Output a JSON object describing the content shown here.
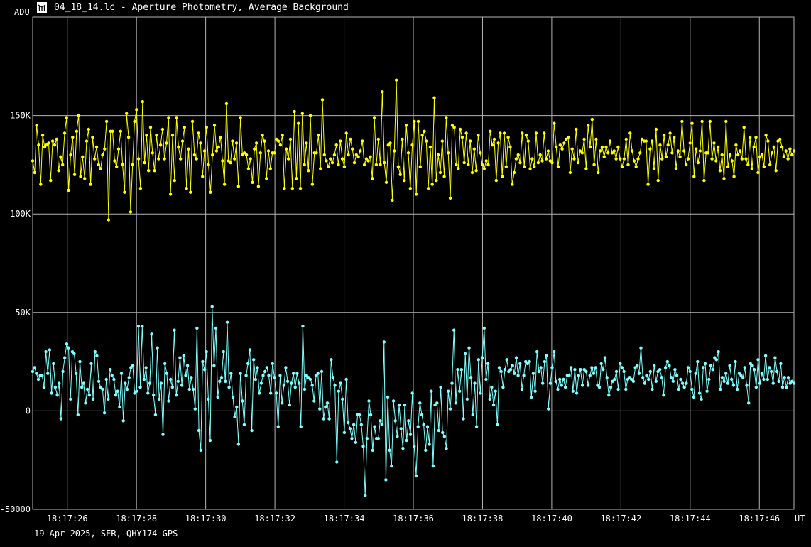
{
  "window": {
    "title": "04_18_14.lc - Aperture Photometry, Average Background",
    "icon": "app-icon"
  },
  "footer": {
    "text": "19 Apr 2025, SER, QHY174-GPS"
  },
  "colors": {
    "background": "#000000",
    "grid": "#b4b4b4",
    "series_target": "#ffff00",
    "series_background": "#80ffff"
  },
  "chart_data": {
    "type": "line",
    "y_unit_label": "ADU",
    "x_unit_label": "UT",
    "xlim": [
      "18:17:25",
      "18:17:47"
    ],
    "ylim": [
      -50000,
      200000
    ],
    "grid": true,
    "x_ticks": [
      "18:17:26",
      "18:17:28",
      "18:17:30",
      "18:17:32",
      "18:17:34",
      "18:17:36",
      "18:17:38",
      "18:17:40",
      "18:17:42",
      "18:17:44",
      "18:17:46"
    ],
    "y_ticks": [
      {
        "value": -50000,
        "label": "-50000"
      },
      {
        "value": 0,
        "label": "0"
      },
      {
        "value": 50000,
        "label": "50K"
      },
      {
        "value": 100000,
        "label": "100K"
      },
      {
        "value": 150000,
        "label": "150K"
      }
    ],
    "series": [
      {
        "color": "#ffff00",
        "style": "line-with-dots",
        "x_start": "18:17:25.0",
        "x_end": "18:17:47.0",
        "values": [
          127000,
          121000,
          145000,
          135000,
          115000,
          140000,
          134000,
          135000,
          136000,
          117000,
          137000,
          135000,
          138000,
          122000,
          129000,
          125000,
          141000,
          149000,
          112000,
          130000,
          139000,
          120000,
          142000,
          150000,
          119000,
          129000,
          118000,
          137000,
          143000,
          115000,
          139000,
          128000,
          134000,
          125000,
          123000,
          130000,
          133000,
          147000,
          97000,
          142000,
          142000,
          127000,
          124000,
          133000,
          142000,
          125000,
          111000,
          151000,
          139000,
          101000,
          125000,
          147000,
          153000,
          128000,
          113000,
          157000,
          126000,
          140000,
          122000,
          144000,
          131000,
          122000,
          140000,
          128000,
          135000,
          143000,
          128000,
          136000,
          149000,
          110000,
          140000,
          117000,
          149000,
          134000,
          128000,
          137000,
          144000,
          113000,
          133000,
          111000,
          147000,
          130000,
          128000,
          141000,
          136000,
          119000,
          132000,
          144000,
          125000,
          111000,
          130000,
          145000,
          132000,
          134000,
          139000,
          127000,
          115000,
          156000,
          127000,
          126000,
          137000,
          128000,
          136000,
          114000,
          149000,
          130000,
          131000,
          130000,
          123000,
          128000,
          116000,
          133000,
          136000,
          114000,
          131000,
          140000,
          137000,
          118000,
          132000,
          123000,
          131000,
          131000,
          138000,
          137000,
          135000,
          140000,
          113000,
          133000,
          128000,
          138000,
          113000,
          152000,
          118000,
          146000,
          113000,
          151000,
          125000,
          136000,
          122000,
          150000,
          115000,
          131000,
          131000,
          140000,
          123000,
          158000,
          130000,
          127000,
          124000,
          128000,
          126000,
          130000,
          135000,
          125000,
          137000,
          128000,
          124000,
          141000,
          130000,
          138000,
          133000,
          126000,
          130000,
          129000,
          132000,
          137000,
          125000,
          128000,
          127000,
          129000,
          118000,
          149000,
          125000,
          138000,
          125000,
          162000,
          126000,
          116000,
          135000,
          136000,
          107000,
          132000,
          168000,
          124000,
          120000,
          138000,
          117000,
          145000,
          131000,
          113000,
          135000,
          147000,
          110000,
          147000,
          124000,
          140000,
          142000,
          137000,
          113000,
          134000,
          115000,
          159000,
          117000,
          130000,
          121000,
          137000,
          119000,
          149000,
          131000,
          108000,
          145000,
          144000,
          125000,
          123000,
          143000,
          139000,
          126000,
          141000,
          125000,
          137000,
          121000,
          133000,
          122000,
          140000,
          131000,
          125000,
          123000,
          127000,
          125000,
          142000,
          135000,
          138000,
          117000,
          136000,
          141000,
          119000,
          141000,
          124000,
          139000,
          134000,
          115000,
          121000,
          128000,
          130000,
          126000,
          141000,
          124000,
          140000,
          137000,
          123000,
          128000,
          124000,
          141000,
          126000,
          130000,
          127000,
          141000,
          128000,
          132000,
          127000,
          126000,
          146000,
          134000,
          124000,
          135000,
          133000,
          136000,
          138000,
          139000,
          121000,
          133000,
          128000,
          143000,
          126000,
          132000,
          131000,
          138000,
          123000,
          145000,
          134000,
          148000,
          125000,
          138000,
          121000,
          132000,
          134000,
          129000,
          134000,
          131000,
          137000,
          131000,
          132000,
          128000,
          134000,
          128000,
          124000,
          128000,
          138000,
          125000,
          141000,
          132000,
          127000,
          124000,
          128000,
          131000,
          138000,
          137000,
          137000,
          115000,
          133000,
          137000,
          123000,
          143000,
          117000,
          135000,
          128000,
          140000,
          129000,
          135000,
          141000,
          131000,
          139000,
          123000,
          132000,
          129000,
          147000,
          132000,
          125000,
          128000,
          136000,
          146000,
          119000,
          133000,
          126000,
          132000,
          147000,
          117000,
          131000,
          131000,
          147000,
          128000,
          136000,
          127000,
          134000,
          122000,
          130000,
          118000,
          147000,
          124000,
          130000,
          127000,
          119000,
          135000,
          130000,
          132000,
          128000,
          144000,
          128000,
          125000,
          139000,
          123000,
          134000,
          139000,
          121000,
          129000,
          130000,
          124000,
          140000,
          137000,
          125000,
          131000,
          134000,
          122000,
          137000,
          138000,
          134000,
          129000,
          132000,
          128000,
          133000,
          130000,
          132000
        ]
      },
      {
        "color": "#80ffff",
        "style": "line-with-dots",
        "x_start": "18:17:25.0",
        "x_end": "18:17:47.0",
        "values": [
          20000,
          22000,
          19000,
          16000,
          18000,
          18000,
          12000,
          30000,
          19000,
          31000,
          9000,
          24000,
          12000,
          8000,
          14000,
          -4000,
          20000,
          27000,
          34000,
          32000,
          6000,
          30000,
          29000,
          19000,
          -2000,
          25000,
          12000,
          14000,
          4000,
          11000,
          8000,
          24000,
          6000,
          30000,
          28000,
          15000,
          12000,
          11000,
          -1000,
          16000,
          6000,
          21000,
          18000,
          16000,
          8000,
          10000,
          2000,
          19000,
          -5000,
          14000,
          11000,
          17000,
          22000,
          23000,
          9000,
          10000,
          43000,
          12000,
          43000,
          16000,
          22000,
          9000,
          14000,
          39000,
          8000,
          -2000,
          32000,
          6000,
          14000,
          -12000,
          24000,
          19000,
          5000,
          16000,
          12000,
          41000,
          8000,
          15000,
          27000,
          13000,
          28000,
          18000,
          23000,
          11000,
          17000,
          11000,
          1000,
          42000,
          -10000,
          -20000,
          25000,
          21000,
          30000,
          6000,
          -15000,
          53000,
          23000,
          42000,
          7000,
          15000,
          17000,
          30000,
          15000,
          45000,
          12000,
          19000,
          7000,
          -3000,
          2000,
          -17000,
          19000,
          5000,
          -7000,
          18000,
          24000,
          31000,
          -10000,
          26000,
          16000,
          22000,
          9000,
          14000,
          18000,
          20000,
          22000,
          18000,
          9000,
          24000,
          17000,
          9000,
          -8000,
          18000,
          4000,
          13000,
          22000,
          15000,
          3000,
          14000,
          19000,
          12000,
          19000,
          14000,
          -8000,
          43000,
          11000,
          18000,
          17000,
          16000,
          13000,
          5000,
          18000,
          19000,
          1000,
          20000,
          -4000,
          2000,
          4000,
          -4000,
          26000,
          17000,
          13000,
          -26000,
          10000,
          14000,
          6000,
          -11000,
          16000,
          -6000,
          -9000,
          -14000,
          -7000,
          -16000,
          -2000,
          -2000,
          -7000,
          -18000,
          -43000,
          -14000,
          5000,
          -2000,
          -20000,
          -8000,
          -14000,
          -14000,
          -5000,
          -7000,
          35000,
          -35000,
          7000,
          -20000,
          -28000,
          5000,
          -5000,
          -13000,
          3000,
          -9000,
          -19000,
          3000,
          -15000,
          -5000,
          -12000,
          9000,
          -18000,
          -33000,
          -8000,
          4000,
          -2000,
          -7000,
          -20000,
          -8000,
          -17000,
          10000,
          -28000,
          3000,
          4000,
          -10000,
          12000,
          -11000,
          -13000,
          -19000,
          10000,
          1000,
          14000,
          41000,
          4000,
          21000,
          10000,
          21000,
          -4000,
          29000,
          6000,
          32000,
          17000,
          -2000,
          14000,
          -8000,
          26000,
          9000,
          27000,
          42000,
          16000,
          24000,
          6000,
          12000,
          3000,
          10000,
          -7000,
          22000,
          20000,
          12000,
          21000,
          26000,
          20000,
          21000,
          23000,
          19000,
          27000,
          18000,
          24000,
          11000,
          18000,
          25000,
          24000,
          25000,
          7000,
          19000,
          10000,
          30000,
          20000,
          22000,
          14000,
          25000,
          28000,
          1000,
          14000,
          22000,
          30000,
          15000,
          11000,
          16000,
          13000,
          16000,
          12000,
          18000,
          18000,
          22000,
          10000,
          21000,
          9000,
          18000,
          21000,
          13000,
          21000,
          20000,
          13000,
          18000,
          22000,
          19000,
          22000,
          13000,
          12000,
          24000,
          21000,
          27000,
          17000,
          8000,
          12000,
          15000,
          16000,
          20000,
          11000,
          24000,
          22000,
          20000,
          11000,
          16000,
          17000,
          16000,
          15000,
          22000,
          23000,
          19000,
          32000,
          17000,
          14000,
          18000,
          16000,
          20000,
          11000,
          23000,
          15000,
          20000,
          21000,
          17000,
          8000,
          22000,
          25000,
          23000,
          17000,
          15000,
          21000,
          18000,
          11000,
          16000,
          14000,
          12000,
          14000,
          22000,
          20000,
          11000,
          7000,
          19000,
          25000,
          9000,
          6000,
          22000,
          24000,
          10000,
          16000,
          23000,
          21000,
          27000,
          26000,
          30000,
          11000,
          17000,
          15000,
          19000,
          14000,
          23000,
          16000,
          13000,
          25000,
          11000,
          19000,
          18000,
          17000,
          22000,
          13000,
          4000,
          24000,
          23000,
          21000,
          12000,
          26000,
          14000,
          19000,
          16000,
          28000,
          16000,
          22000,
          20000,
          14000,
          27000,
          20000,
          15000,
          24000,
          12000,
          17000,
          12000,
          17000,
          14000,
          15000,
          14000
        ]
      }
    ]
  }
}
